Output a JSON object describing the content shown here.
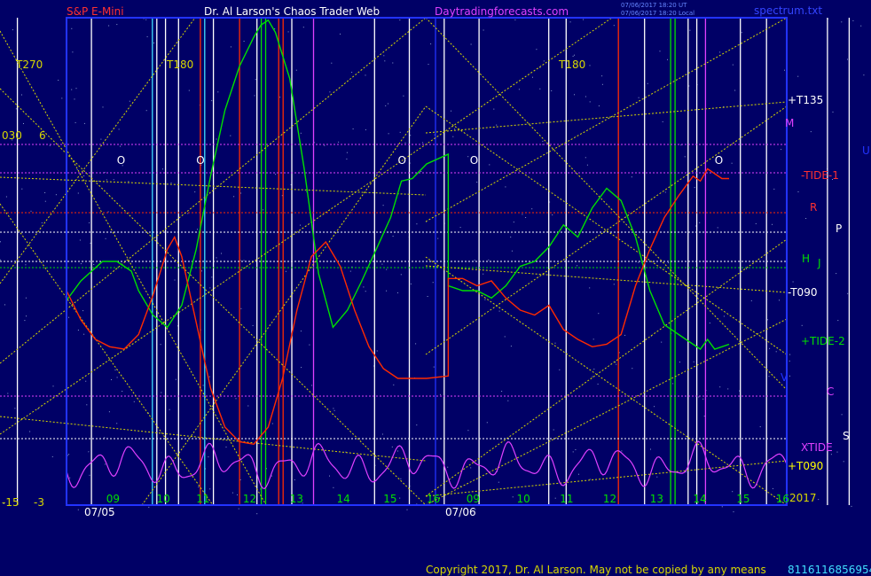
{
  "header": {
    "left_title": "S&P E-Mini",
    "center_title": "Dr. Al Larson's Chaos Trader Web",
    "site": "Daytradingforecasts.com",
    "stamp_line1": "07/06/2017 18:20 UT",
    "stamp_line2": "07/06/2017 18:20 Local",
    "file_name": "spectrum.txt"
  },
  "footer": {
    "copyright": "Copyright 2017, Dr. Al Larson. May not be copied by any means",
    "id_text": "8116116856954"
  },
  "colors": {
    "background": "#000066",
    "plot_bg": "#000066",
    "frame": "#2233ff",
    "price": "#00e000",
    "red_line": "#ff2a00",
    "xtide": "#e040ff",
    "yellow": "#d8d800",
    "white": "#ffffff",
    "cyan": "#40e0ff"
  },
  "chart_data": {
    "type": "line",
    "title": "S&P E-Mini",
    "dates": [
      "07/05",
      "07/06"
    ],
    "x_ticks": [
      "09",
      "10",
      "11",
      "12",
      "13",
      "14",
      "15",
      "16",
      "09",
      "10",
      "11",
      "12",
      "13",
      "14",
      "15",
      "16"
    ],
    "left_labels": [
      "T270",
      "030",
      "6",
      "-15",
      "-3"
    ],
    "top_labels": [
      "T180",
      "T180"
    ],
    "right_labels": [
      "+T135",
      "M",
      "U",
      "-TIDE-1",
      "R",
      "P",
      "H",
      "J",
      "-T090",
      "+TIDE-2",
      "V",
      "C",
      "XTIDE",
      "S",
      "+T090",
      "2017"
    ],
    "series": [
      {
        "name": "price",
        "color": "#00e000",
        "points": [
          [
            0.0,
            0.84
          ],
          [
            0.02,
            0.92
          ],
          [
            0.05,
            1.0
          ],
          [
            0.07,
            1.0
          ],
          [
            0.09,
            0.96
          ],
          [
            0.1,
            0.88
          ],
          [
            0.12,
            0.78
          ],
          [
            0.14,
            0.73
          ],
          [
            0.16,
            0.82
          ],
          [
            0.18,
            1.05
          ],
          [
            0.2,
            1.35
          ],
          [
            0.22,
            1.62
          ],
          [
            0.24,
            1.8
          ],
          [
            0.26,
            1.92
          ],
          [
            0.27,
            1.97
          ],
          [
            0.28,
            1.99
          ],
          [
            0.29,
            1.94
          ],
          [
            0.31,
            1.75
          ],
          [
            0.33,
            1.38
          ],
          [
            0.35,
            0.95
          ],
          [
            0.37,
            0.73
          ],
          [
            0.39,
            0.8
          ],
          [
            0.41,
            0.92
          ],
          [
            0.43,
            1.05
          ],
          [
            0.45,
            1.18
          ],
          [
            0.465,
            1.33
          ],
          [
            0.48,
            1.34
          ],
          [
            0.5,
            1.4
          ],
          [
            0.53,
            1.44
          ],
          [
            0.53,
            0.9
          ],
          [
            0.55,
            0.88
          ],
          [
            0.57,
            0.88
          ],
          [
            0.59,
            0.85
          ],
          [
            0.61,
            0.9
          ],
          [
            0.63,
            0.98
          ],
          [
            0.65,
            1.0
          ],
          [
            0.67,
            1.06
          ],
          [
            0.69,
            1.15
          ],
          [
            0.71,
            1.1
          ],
          [
            0.73,
            1.22
          ],
          [
            0.75,
            1.3
          ],
          [
            0.77,
            1.25
          ],
          [
            0.79,
            1.1
          ],
          [
            0.81,
            0.88
          ],
          [
            0.83,
            0.74
          ],
          [
            0.85,
            0.7
          ],
          [
            0.87,
            0.66
          ],
          [
            0.88,
            0.64
          ],
          [
            0.89,
            0.68
          ],
          [
            0.9,
            0.64
          ],
          [
            0.91,
            0.65
          ],
          [
            0.92,
            0.66
          ]
        ]
      },
      {
        "name": "red",
        "color": "#ff2a00",
        "points": [
          [
            0.0,
            0.88
          ],
          [
            0.02,
            0.76
          ],
          [
            0.04,
            0.68
          ],
          [
            0.06,
            0.65
          ],
          [
            0.08,
            0.64
          ],
          [
            0.1,
            0.7
          ],
          [
            0.12,
            0.86
          ],
          [
            0.14,
            1.05
          ],
          [
            0.15,
            1.1
          ],
          [
            0.16,
            1.02
          ],
          [
            0.18,
            0.75
          ],
          [
            0.2,
            0.48
          ],
          [
            0.22,
            0.32
          ],
          [
            0.24,
            0.26
          ],
          [
            0.26,
            0.25
          ],
          [
            0.28,
            0.32
          ],
          [
            0.3,
            0.52
          ],
          [
            0.32,
            0.8
          ],
          [
            0.34,
            1.02
          ],
          [
            0.36,
            1.08
          ],
          [
            0.38,
            0.98
          ],
          [
            0.4,
            0.8
          ],
          [
            0.42,
            0.65
          ],
          [
            0.44,
            0.56
          ],
          [
            0.46,
            0.52
          ],
          [
            0.48,
            0.52
          ],
          [
            0.5,
            0.52
          ],
          [
            0.53,
            0.53
          ],
          [
            0.53,
            0.93
          ],
          [
            0.55,
            0.93
          ],
          [
            0.57,
            0.9
          ],
          [
            0.59,
            0.92
          ],
          [
            0.61,
            0.85
          ],
          [
            0.63,
            0.8
          ],
          [
            0.65,
            0.78
          ],
          [
            0.67,
            0.82
          ],
          [
            0.69,
            0.72
          ],
          [
            0.71,
            0.68
          ],
          [
            0.73,
            0.65
          ],
          [
            0.75,
            0.66
          ],
          [
            0.77,
            0.7
          ],
          [
            0.79,
            0.9
          ],
          [
            0.81,
            1.05
          ],
          [
            0.83,
            1.18
          ],
          [
            0.85,
            1.27
          ],
          [
            0.87,
            1.35
          ],
          [
            0.88,
            1.33
          ],
          [
            0.89,
            1.38
          ],
          [
            0.9,
            1.36
          ],
          [
            0.91,
            1.34
          ],
          [
            0.92,
            1.34
          ]
        ]
      }
    ],
    "xtide": {
      "name": "XTIDE",
      "color": "#e040ff"
    },
    "markers": [
      {
        "text": "O",
        "x": 0.07
      },
      {
        "text": "O",
        "x": 0.18
      },
      {
        "text": "O",
        "x": 0.46
      },
      {
        "text": "O",
        "x": 0.56
      },
      {
        "text": "O",
        "x": 0.9
      }
    ]
  }
}
